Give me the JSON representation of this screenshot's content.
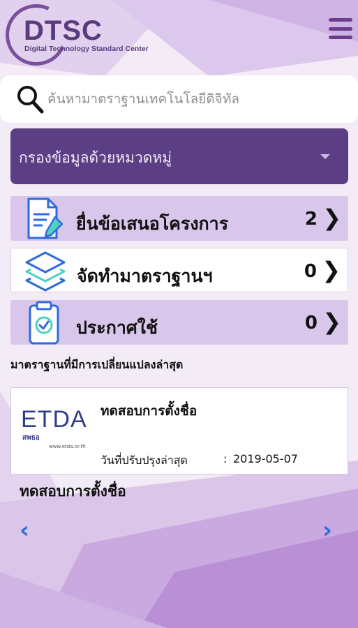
{
  "header": {
    "logo_title": "DTSC",
    "logo_subtitle": "Digital Technology Standard Center",
    "menu_icon": "hamburger-menu-icon"
  },
  "search": {
    "placeholder": "ค้นหามาตราฐานเทคโนโลยีดิจิทัล",
    "value": "",
    "icon": "search-icon"
  },
  "filter": {
    "label": "กรองข้อมูลด้วยหมวดหมู่",
    "icon": "caret-down-icon"
  },
  "stages": [
    {
      "label": "ยื่นข้อเสนอโครงการ",
      "count": "2",
      "chevron": "❯",
      "icon": "document-edit-icon"
    },
    {
      "label": "จัดทำมาตราฐานฯ",
      "count": "0",
      "chevron": "❯",
      "icon": "layers-icon"
    },
    {
      "label": "ประกาศใช้",
      "count": "0",
      "chevron": "❯",
      "icon": "clipboard-check-icon"
    }
  ],
  "recent": {
    "section_title": "มาตราฐานที่มีการเปลี่ยนแปลงล่าสุด",
    "card": {
      "logo_text": "ETDA",
      "logo_thai": "สพธอ",
      "logo_url": "www.etda.or.th",
      "title": "ทดสอบการตั้งชื่อ",
      "date_label": "วันที่ปรับปรุงล่าสุด",
      "date_separator": ":",
      "date_value": "2019-05-07"
    },
    "below_title": "ทดสอบการตั้งชื่อ",
    "prev_label": "‹",
    "next_label": "›"
  },
  "colors": {
    "accent": "#5b3e84",
    "row_highlight": "#d8c7ea",
    "nav_arrow": "#2f6bdc",
    "etda_blue": "#2f3d8c"
  }
}
